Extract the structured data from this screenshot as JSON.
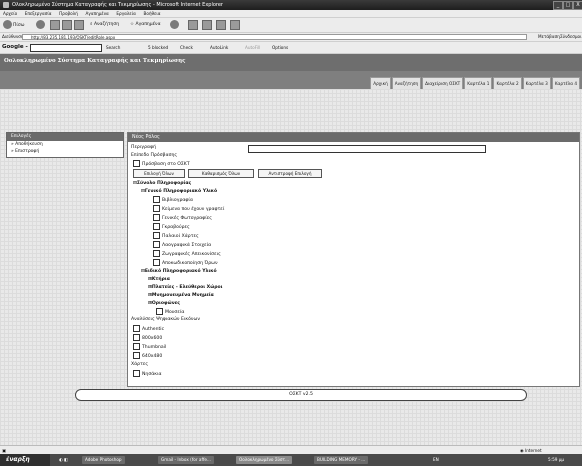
{
  "window": {
    "title": "Ολοκληρωμένο Σύστημα Καταγραφής και Τεκμηρίωσης - Microsoft Internet Explorer",
    "controls": [
      "_",
      "□",
      "X"
    ]
  },
  "menu": [
    "Αρχείο",
    "Επεξεργασία",
    "Προβολή",
    "Αγαπημένα",
    "Εργαλεία",
    "Βοήθεια"
  ],
  "toolbar": {
    "back": "Πίσω",
    "search": "Αναζήτηση",
    "favorites": "Αγαπημένα"
  },
  "address": {
    "label": "Διεύθυνση",
    "url": "http://83.235.181.193/OSKT/editRole.aspx",
    "go": "Μετάβαση",
    "links": "Σύνδεσμοι"
  },
  "google_bar": {
    "brand": "Google -",
    "search": "Search",
    "blocked": "5 blocked",
    "check": "Check",
    "autolink": "AutoLink",
    "autofill": "AutoFill",
    "options": "Options"
  },
  "app": {
    "title": "Οολοκληρωμένο Σύστημα Καταγραφής και Τεκμηρίωσης",
    "tabs": [
      "Αρχική",
      "Αναζήτηση",
      "Διαχείριση ΟΣΚΤ",
      "Καρτέλα 1",
      "Καρτέλα 2",
      "Καρτέλα 3",
      "Καρτέλα 4"
    ]
  },
  "sidebar": {
    "header": "Επιλογές",
    "items": [
      "» Αποθήκευση",
      "» Επιστροφή"
    ]
  },
  "main": {
    "header": "Νέος Ρόλος",
    "description_label": "Περιγραφή",
    "access_level_label": "Επίπεδο Πρόσβασης",
    "access_oskt": "Πρόσβαση στο ΟΣΚΤ",
    "buttons": {
      "select_all": "Επιλογή Όλων",
      "clear_all": "Καθαρισμός Όλων",
      "invert": "Αντιστροφή Επιλογή"
    },
    "tree": {
      "root": "Σύνολο Πληροφορίας",
      "general": "Γενικό Πληροφοριακό Υλικό",
      "general_items": [
        "Βιβλιογραφία",
        "Κείμενα που έχουν γραφτεί",
        "Γενικές Φωτογραφίες",
        "Γκραβούρες",
        "Παλαιοί Χάρτες",
        "Λαογραφικά Στοιχεία",
        "Ζωγραφικές Απεικονίσεις",
        "Αποκωδικοποίηση Όρων"
      ],
      "special": "Ειδικό Πληροφοριακό Υλικό",
      "special_items": [
        "Κτήρια",
        "Πλατείες - Ελεύθεροι Χώροι",
        "Μνημονευμένα Μνημεία",
        "Οριοφώνες"
      ],
      "museum": "Μουσεία"
    },
    "image_analysis_label": "Αναλύσεις Ψηφιακών Εικόνων",
    "image_options": [
      "Authentic",
      "800x600",
      "Thumbnail",
      "640x480"
    ],
    "maps_label": "Χάρτες",
    "maps_options": [
      "Νησάκια"
    ]
  },
  "footer": "ΟΣΚΤ v2.5",
  "status": {
    "zone": "Internet"
  },
  "taskbar": {
    "start": "έναρξη",
    "tasks": [
      "Adobe Photoshop",
      "Gmail - Inbox (for affe...",
      "Οολοκληρωμένο Σύστ...",
      "BUILDING MEMORY - ..."
    ],
    "lang": "EN",
    "clock": "5:59 μμ"
  },
  "colors": {
    "header_gray": "#6b6b6b",
    "panel_border": "#777777",
    "page_bg": "#e9e9e9"
  }
}
